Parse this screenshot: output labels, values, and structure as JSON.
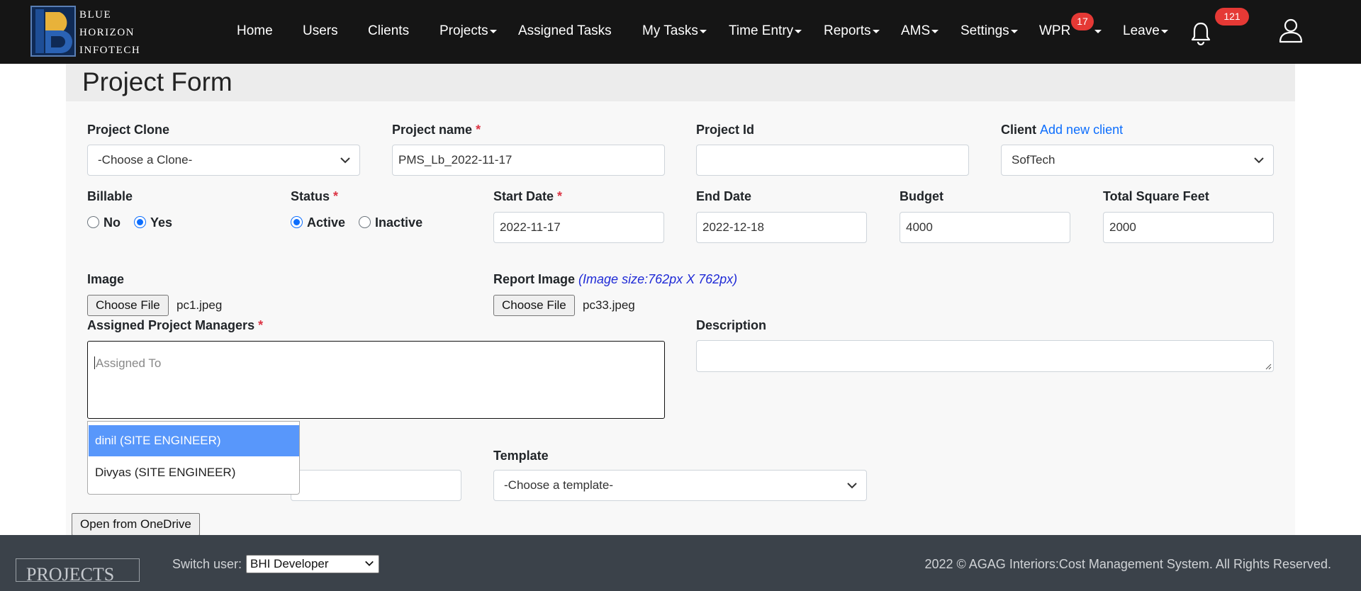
{
  "brand": {
    "line1": "BLUE",
    "line2": "HORIZON",
    "line3": "INFOTECH",
    "colors": {
      "navbar": "#151515",
      "logo_blue": "#1e4e96",
      "logo_gold": "#e8b23a",
      "badge": "#e53935",
      "accent": "#0d6efd"
    }
  },
  "nav": {
    "home": "Home",
    "users": "Users",
    "clients": "Clients",
    "projects": "Projects",
    "assigned_tasks": "Assigned Tasks",
    "my_tasks": "My Tasks",
    "time_entry": "Time Entry",
    "reports": "Reports",
    "ams": "AMS",
    "settings": "Settings",
    "wpr": "WPR",
    "wpr_badge": "17",
    "leave": "Leave",
    "notifications_badge": "121",
    "icons": [
      "bell-icon",
      "user-icon",
      "chevron-down-icon"
    ]
  },
  "form": {
    "title": "Project Form",
    "project_clone": {
      "label": "Project Clone",
      "value": "-Choose a Clone-"
    },
    "project_name": {
      "label": "Project name",
      "required": "*",
      "value": "PMS_Lb_2022-11-17"
    },
    "project_id": {
      "label": "Project Id",
      "value": ""
    },
    "client": {
      "label": "Client",
      "add_link": "Add new client",
      "value": "SofTech"
    },
    "billable": {
      "label": "Billable",
      "options": [
        "No",
        "Yes"
      ],
      "selected": "Yes"
    },
    "status": {
      "label": "Status",
      "required": "*",
      "options": [
        "Active",
        "Inactive"
      ],
      "selected": "Active"
    },
    "start_date": {
      "label": "Start Date",
      "required": "*",
      "value": "2022-11-17"
    },
    "end_date": {
      "label": "End Date",
      "value": "2022-12-18"
    },
    "budget": {
      "label": "Budget",
      "value": "4000"
    },
    "total_sqft": {
      "label": "Total Square Feet",
      "value": "2000"
    },
    "image": {
      "label": "Image",
      "button": "Choose File",
      "file": "pc1.jpeg"
    },
    "report_image": {
      "label": "Report Image",
      "hint": "(Image size:762px X 762px)",
      "button": "Choose File",
      "file": "pc33.jpeg"
    },
    "managers": {
      "label": "Assigned Project Managers",
      "required": "*",
      "placeholder": "Assigned To",
      "options": [
        "dinil (SITE ENGINEER)",
        "Divyas (SITE ENGINEER)"
      ],
      "highlighted": "dinil (SITE ENGINEER)"
    },
    "description": {
      "label": "Description",
      "value": ""
    },
    "template": {
      "label": "Template",
      "value": "-Choose a template-"
    },
    "onedrive_button": "Open from OneDrive"
  },
  "footer": {
    "logo_text": "PROJECTS",
    "switch_user_label": "Switch user:",
    "switch_user_value": "BHI Developer",
    "copyright": "2022 © AGAG Interiors:Cost Management System. All Rights Reserved."
  }
}
